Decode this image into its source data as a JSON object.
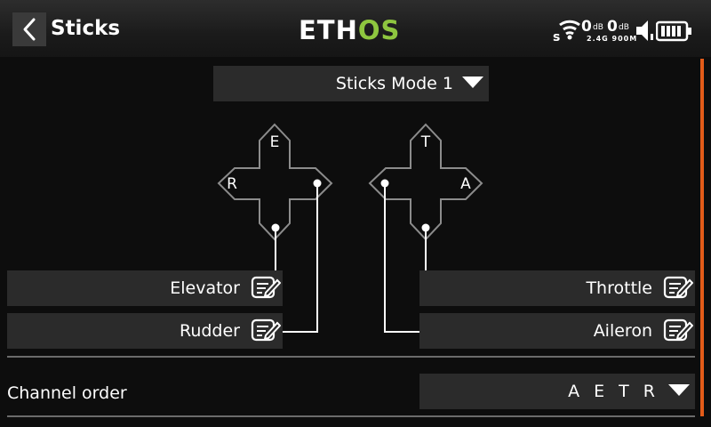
{
  "header": {
    "title": "Sticks",
    "logo_left": "ETH",
    "logo_right": "OS",
    "rssi_1": "0",
    "rssi_1_unit": "dB",
    "rssi_2": "0",
    "rssi_2_unit": "dB",
    "rssi_sub": "2.4G 900M",
    "icons": [
      "back-arrow-icon",
      "wifi-signal-icon",
      "speaker-icon",
      "battery-icon"
    ]
  },
  "sticks": {
    "mode": "Sticks Mode 1",
    "left_stick": {
      "up": "E",
      "left": "R"
    },
    "right_stick": {
      "up": "T",
      "right": "A"
    },
    "assignments": {
      "elevator": "Elevator",
      "rudder": "Rudder",
      "throttle": "Throttle",
      "aileron": "Aileron"
    }
  },
  "channel_order": {
    "label": "Channel order",
    "value": "A E T R"
  },
  "colors": {
    "accent_green": "#8ec63f",
    "scroll_orange": "#e35b19",
    "panel": "#2b2b2b",
    "background": "#0d0d0d"
  }
}
